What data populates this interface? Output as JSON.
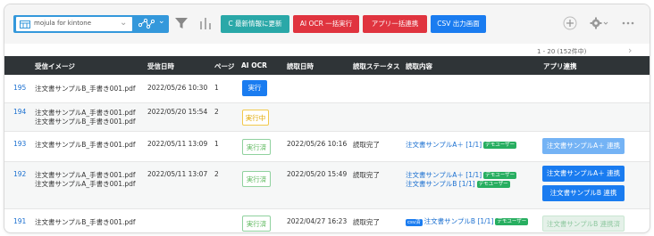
{
  "toolbar": {
    "app_selector": {
      "text": "mojula for kintone"
    },
    "buttons": {
      "refresh": "C 最新情報に更新",
      "ai_ocr": "AI OCR 一括実行",
      "app_link": "アプリ一括連携",
      "csv": "CSV 出力画面"
    }
  },
  "pagination": {
    "text": "1 - 20  (152件中)"
  },
  "table": {
    "headers": {
      "image": "受信イメージ",
      "received": "受信日時",
      "page": "ページ",
      "ocr": "AI OCR",
      "read_date": "読取日時",
      "read_status": "読取ステータス",
      "content": "読取内容",
      "app_link": "アプリ連携"
    },
    "rows": [
      {
        "id": "195",
        "files": [
          "注文書サンプルB_手書き001.pdf"
        ],
        "received": "2022/05/26 10:30",
        "page": "1",
        "ocr": "実行",
        "read_date": "",
        "status": "",
        "contents": [],
        "link_buttons": []
      },
      {
        "id": "194",
        "files": [
          "注文書サンプルA_手書き001.pdf",
          "注文書サンプルB_手書き001.pdf"
        ],
        "received": "2022/05/20 15:54",
        "page": "2",
        "ocr": "実行中",
        "read_date": "",
        "status": "",
        "contents": [],
        "link_buttons": []
      },
      {
        "id": "193",
        "files": [
          "注文書サンプルB_手書き001.pdf"
        ],
        "received": "2022/05/11 13:09",
        "page": "1",
        "ocr": "実行済",
        "read_date": "2022/05/26 10:16",
        "status": "読取完了",
        "contents": [
          {
            "text": "注文書サンプルA＋ [1/1]",
            "badge": "デモユーザー"
          }
        ],
        "link_buttons": [
          {
            "label": "注文書サンプルA＋ 連携"
          }
        ]
      },
      {
        "id": "192",
        "files": [
          "注文書サンプルA_手書き001.pdf",
          "注文書サンプルA_手書き001.pdf"
        ],
        "received": "2022/05/11 13:07",
        "page": "2",
        "ocr": "実行済",
        "read_date": "2022/05/20 15:49",
        "status": "読取完了",
        "contents": [
          {
            "text": "注文書サンプルA＋ [1/1]",
            "badge": "デモユーザー"
          },
          {
            "text": "注文書サンプルB [1/1]",
            "badge": "デモユーザー"
          }
        ],
        "link_buttons": [
          {
            "label": "注文書サンプルA＋ 連携"
          },
          {
            "label": "注文書サンプルB 連携"
          }
        ]
      },
      {
        "id": "191",
        "files": [
          "注文書サンプルB_手書き001.pdf"
        ],
        "received": "",
        "page": "",
        "ocr": "実行済",
        "read_date": "2022/04/27 16:23",
        "status": "読取完了",
        "contents": [
          {
            "prefix_badge": "csv済",
            "text": "注文書サンプルB [1/1]",
            "badge": "デモユーザー"
          }
        ],
        "link_buttons": [
          {
            "label": "注文書サンプルB 連携済"
          }
        ]
      }
    ]
  },
  "colors": {
    "header_bg": "#2f3437",
    "primary": "#1a7cf0",
    "teal": "#2aa8a8",
    "red": "#e0343f",
    "green_badge": "#27ae60"
  }
}
